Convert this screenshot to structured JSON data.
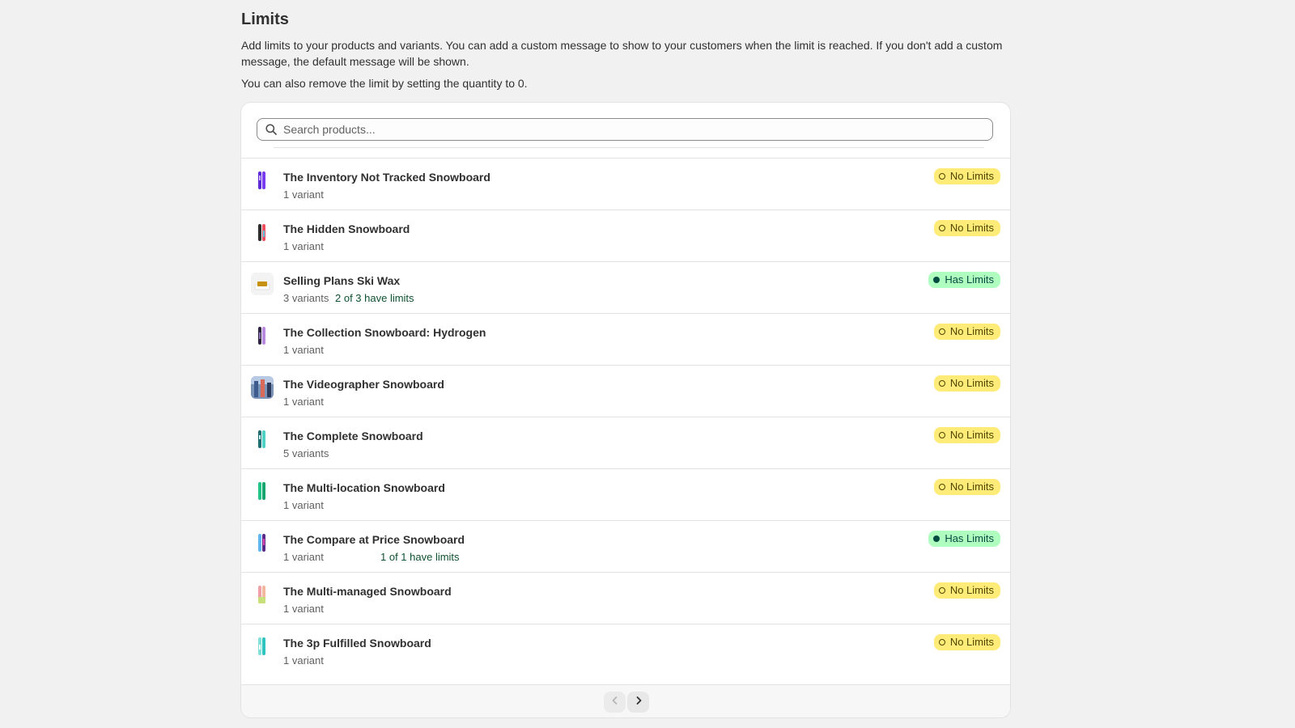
{
  "page": {
    "title": "Limits",
    "description": "Add limits to your products and variants. You can add a custom message to show to your customers when the limit is reached. If you don't add a custom message, the default message will be shown.",
    "description2": "You can also remove the limit by setting the quantity to 0."
  },
  "search": {
    "placeholder": "Search products..."
  },
  "colors": {
    "no_limits_bg": "#ffeb78",
    "has_limits_bg": "#affebf",
    "limits_text": "#0c5132"
  },
  "products": [
    {
      "name": "The Inventory Not Tracked Snowboard",
      "variants": "1 variant",
      "limits_text": "",
      "status": "No Limits",
      "has_limits": false,
      "thumb": "purple-board"
    },
    {
      "name": "The Hidden Snowboard",
      "variants": "1 variant",
      "limits_text": "",
      "status": "No Limits",
      "has_limits": false,
      "thumb": "red-board"
    },
    {
      "name": "Selling Plans Ski Wax",
      "variants": "3 variants",
      "limits_text": "2 of 3 have limits",
      "status": "Has Limits",
      "has_limits": true,
      "thumb": "wax-bar"
    },
    {
      "name": "The Collection Snowboard: Hydrogen",
      "variants": "1 variant",
      "limits_text": "",
      "status": "No Limits",
      "has_limits": false,
      "thumb": "dark-board"
    },
    {
      "name": "The Videographer Snowboard",
      "variants": "1 variant",
      "limits_text": "",
      "status": "No Limits",
      "has_limits": false,
      "thumb": "photo"
    },
    {
      "name": "The Complete Snowboard",
      "variants": "5 variants",
      "limits_text": "",
      "status": "No Limits",
      "has_limits": false,
      "thumb": "teal-board"
    },
    {
      "name": "The Multi-location Snowboard",
      "variants": "1 variant",
      "limits_text": "",
      "status": "No Limits",
      "has_limits": false,
      "thumb": "green-board"
    },
    {
      "name": "The Compare at Price Snowboard",
      "variants": "1 variant",
      "limits_text": "1 of 1 have limits",
      "status": "Has Limits",
      "has_limits": true,
      "thumb": "blue-board"
    },
    {
      "name": "The Multi-managed Snowboard",
      "variants": "1 variant",
      "limits_text": "",
      "status": "No Limits",
      "has_limits": false,
      "thumb": "pastel-board"
    },
    {
      "name": "The 3p Fulfilled Snowboard",
      "variants": "1 variant",
      "limits_text": "",
      "status": "No Limits",
      "has_limits": false,
      "thumb": "aqua-board"
    }
  ],
  "pagination": {
    "prev_enabled": false,
    "next_enabled": true
  }
}
